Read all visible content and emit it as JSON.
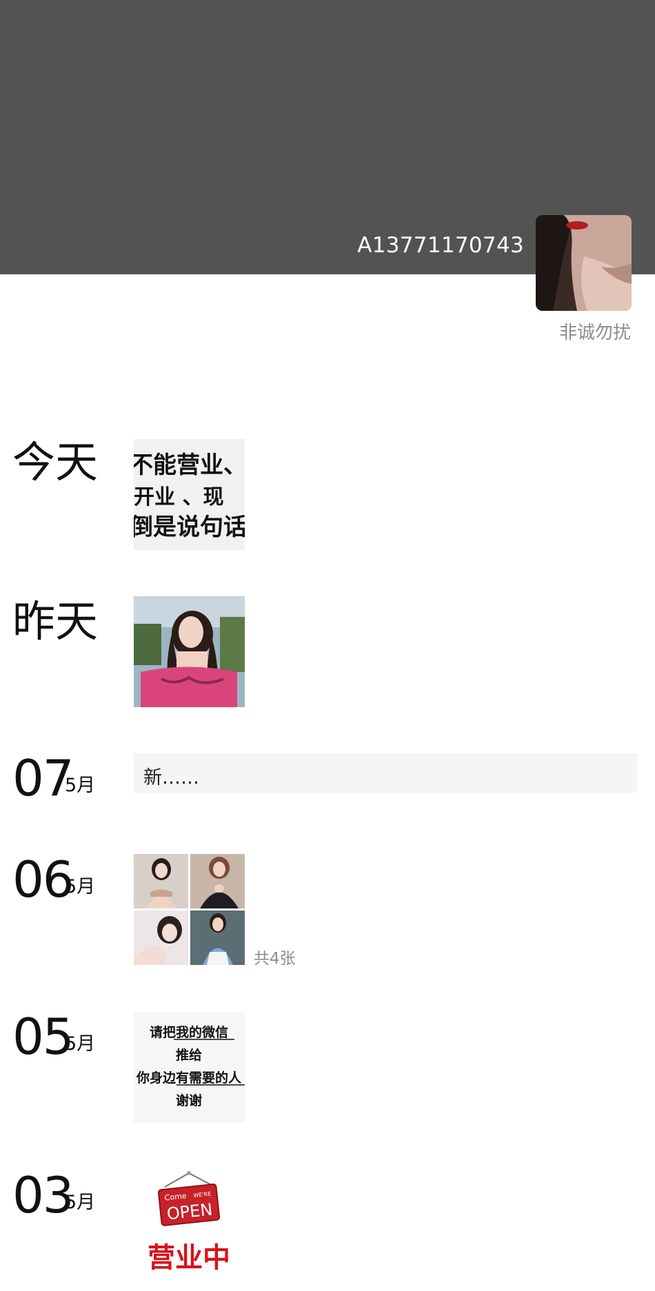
{
  "profile": {
    "name": "A13771170743",
    "signature": "非诚勿扰"
  },
  "colors": {
    "cover": "#535353",
    "accent_red": "#d8121b"
  },
  "posts": [
    {
      "date_label": "今天",
      "type": "image",
      "image_text": [
        "不能营业、",
        "开业    、现",
        "倒是说句话"
      ]
    },
    {
      "date_label": "昨天",
      "type": "image"
    },
    {
      "day": "07",
      "month": "5月",
      "type": "text",
      "text": "新……"
    },
    {
      "day": "06",
      "month": "5月",
      "type": "gallery",
      "count_label": "共4张"
    },
    {
      "day": "05",
      "month": "5月",
      "type": "image",
      "image_text": [
        "请把我的微信",
        "推给",
        "你身边有需要的人",
        "谢谢"
      ]
    },
    {
      "day": "03",
      "month": "5月",
      "type": "image",
      "image_text": [
        "Come",
        "WE'RE",
        "OPEN",
        "营业中"
      ]
    }
  ]
}
